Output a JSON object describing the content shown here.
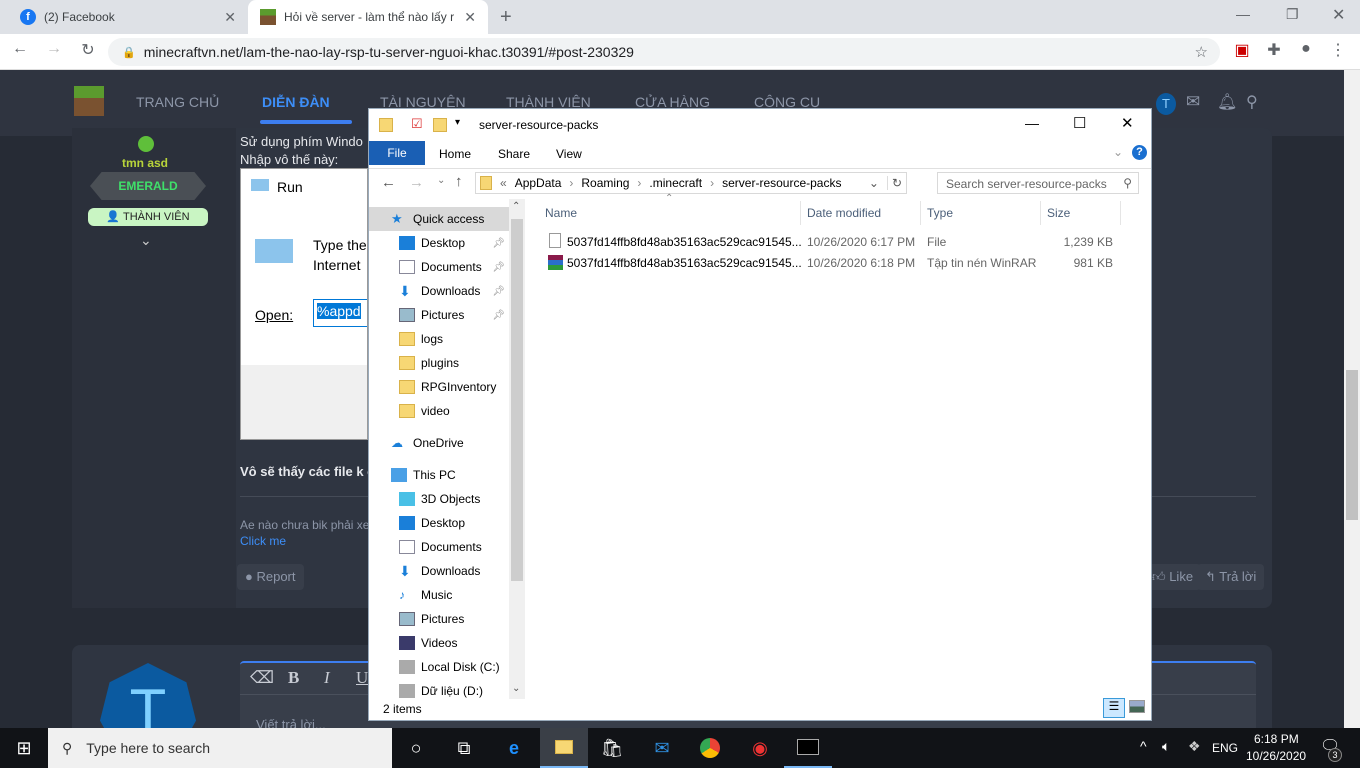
{
  "browser": {
    "tabs": [
      {
        "title": "(2) Facebook",
        "icon": "facebook-icon"
      },
      {
        "title": "Hỏi về server - làm thể nào lấy rs",
        "icon": "minecraft-grass-icon"
      }
    ],
    "url": "minecraftvn.net/lam-the-nao-lay-rsp-tu-server-nguoi-khac.t30391/#post-230329"
  },
  "site": {
    "nav": [
      "TRANG CHỦ",
      "DIỄN ĐÀN",
      "TÀI NGUYÊN",
      "THÀNH VIÊN",
      "CỬA HÀNG",
      "CÔNG CỤ"
    ],
    "active_nav": "DIỄN ĐÀN",
    "user_avatar_letter": "T",
    "post": {
      "author": "tmn asd",
      "rank_badge": "EMERALD",
      "role": "THÀNH VIÊN",
      "line1": "Sử dụng phím Windo",
      "line2": "Nhập vô thế này:",
      "run_title": "Run",
      "run_text1": "Type the",
      "run_text2": "Internet",
      "run_open_label": "Open:",
      "run_value": "%appd",
      "line3": "Vô sẽ thấy các file k c",
      "signature": "Ae nào chưa bik phải xe",
      "signature_link": "Click me",
      "report": "Report",
      "like": "Like",
      "reply": "Trả lời"
    },
    "reply_box": {
      "avatar_letter": "T",
      "placeholder": "Viết trả lời...",
      "toolbar": [
        "eraser",
        "B",
        "I",
        "U"
      ]
    }
  },
  "explorer": {
    "title": "server-resource-packs",
    "ribbon_tabs": [
      "File",
      "Home",
      "Share",
      "View"
    ],
    "breadcrumb": [
      "AppData",
      "Roaming",
      ".minecraft",
      "server-resource-packs"
    ],
    "search_placeholder": "Search server-resource-packs",
    "nav_pane": [
      {
        "label": "Quick access",
        "icon": "star-icon",
        "selected": true
      },
      {
        "label": "Desktop",
        "icon": "desktop-icon",
        "pinned": true
      },
      {
        "label": "Documents",
        "icon": "documents-icon",
        "pinned": true
      },
      {
        "label": "Downloads",
        "icon": "downloads-icon",
        "pinned": true
      },
      {
        "label": "Pictures",
        "icon": "pictures-icon",
        "pinned": true
      },
      {
        "label": "logs",
        "icon": "folder-icon"
      },
      {
        "label": "plugins",
        "icon": "folder-icon"
      },
      {
        "label": "RPGInventory",
        "icon": "folder-icon"
      },
      {
        "label": "video",
        "icon": "folder-icon"
      },
      {
        "label": "OneDrive",
        "icon": "cloud-icon"
      },
      {
        "label": "This PC",
        "icon": "pc-icon"
      },
      {
        "label": "3D Objects",
        "icon": "cube-icon"
      },
      {
        "label": "Desktop",
        "icon": "desktop-icon"
      },
      {
        "label": "Documents",
        "icon": "documents-icon"
      },
      {
        "label": "Downloads",
        "icon": "downloads-icon"
      },
      {
        "label": "Music",
        "icon": "music-icon"
      },
      {
        "label": "Pictures",
        "icon": "pictures-icon"
      },
      {
        "label": "Videos",
        "icon": "videos-icon"
      },
      {
        "label": "Local Disk (C:)",
        "icon": "disk-icon"
      },
      {
        "label": "Dữ liệu (D:)",
        "icon": "disk-icon"
      }
    ],
    "columns": [
      "Name",
      "Date modified",
      "Type",
      "Size"
    ],
    "files": [
      {
        "name": "5037fd14ffb8fd48ab35163ac529cac91545...",
        "date": "10/26/2020 6:17 PM",
        "type": "File",
        "size": "1,239 KB",
        "icon": "file-icon"
      },
      {
        "name": "5037fd14ffb8fd48ab35163ac529cac91545...",
        "date": "10/26/2020 6:18 PM",
        "type": "Tập tin nén WinRAR",
        "size": "981 KB",
        "icon": "winrar-icon"
      }
    ],
    "status": "2 items"
  },
  "taskbar": {
    "search_placeholder": "Type here to search",
    "lang": "ENG",
    "time": "6:18 PM",
    "date": "10/26/2020",
    "notifications": "3"
  }
}
